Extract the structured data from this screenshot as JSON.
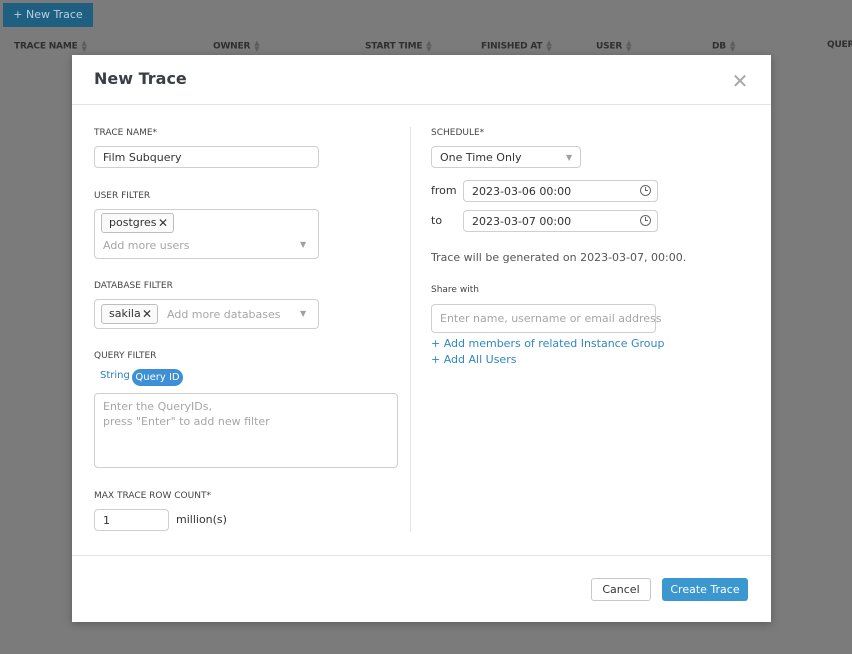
{
  "background": {
    "new_trace_button": "+ New Trace",
    "columns": [
      "TRACE NAME",
      "OWNER",
      "START TIME",
      "FINISHED AT",
      "USER",
      "DB",
      "QUER"
    ]
  },
  "modal": {
    "title": "New Trace",
    "trace_name_label": "TRACE NAME*",
    "trace_name_value": "Film Subquery",
    "user_filter_label": "USER FILTER",
    "user_filter_tags": [
      "postgres"
    ],
    "user_filter_placeholder": "Add more users",
    "database_filter_label": "DATABASE FILTER",
    "database_filter_tags": [
      "sakila"
    ],
    "database_filter_placeholder": "Add more databases",
    "query_filter_label": "QUERY FILTER",
    "query_filter_modes": [
      "String",
      "Query ID"
    ],
    "query_filter_selected": "Query ID",
    "query_filter_placeholder_line1": "Enter the QueryIDs,",
    "query_filter_placeholder_line2": "press \"Enter\" to add new filter",
    "max_row_count_label": "MAX TRACE ROW COUNT*",
    "max_row_count_value": "1",
    "max_row_count_unit": "million(s)",
    "schedule_label": "SCHEDULE*",
    "schedule_value": "One Time Only",
    "from_label": "from",
    "from_value": "2023-03-06 00:00",
    "to_label": "to",
    "to_value": "2023-03-07 00:00",
    "generation_note": "Trace will be generated on 2023-03-07, 00:00.",
    "share_with_label": "Share with",
    "share_with_placeholder": "Enter name, username or email address",
    "add_group_link": "+ Add members of related Instance Group",
    "add_all_link": "+ Add All Users",
    "cancel_label": "Cancel",
    "create_label": "Create Trace"
  },
  "colors": {
    "primary": "#3b97d0",
    "link": "#2f86c5",
    "overlay": "#7b7b7b"
  },
  "icons": [
    "close-icon",
    "remove-tag-icon",
    "chevron-down-icon",
    "clock-icon",
    "sort-icon"
  ]
}
